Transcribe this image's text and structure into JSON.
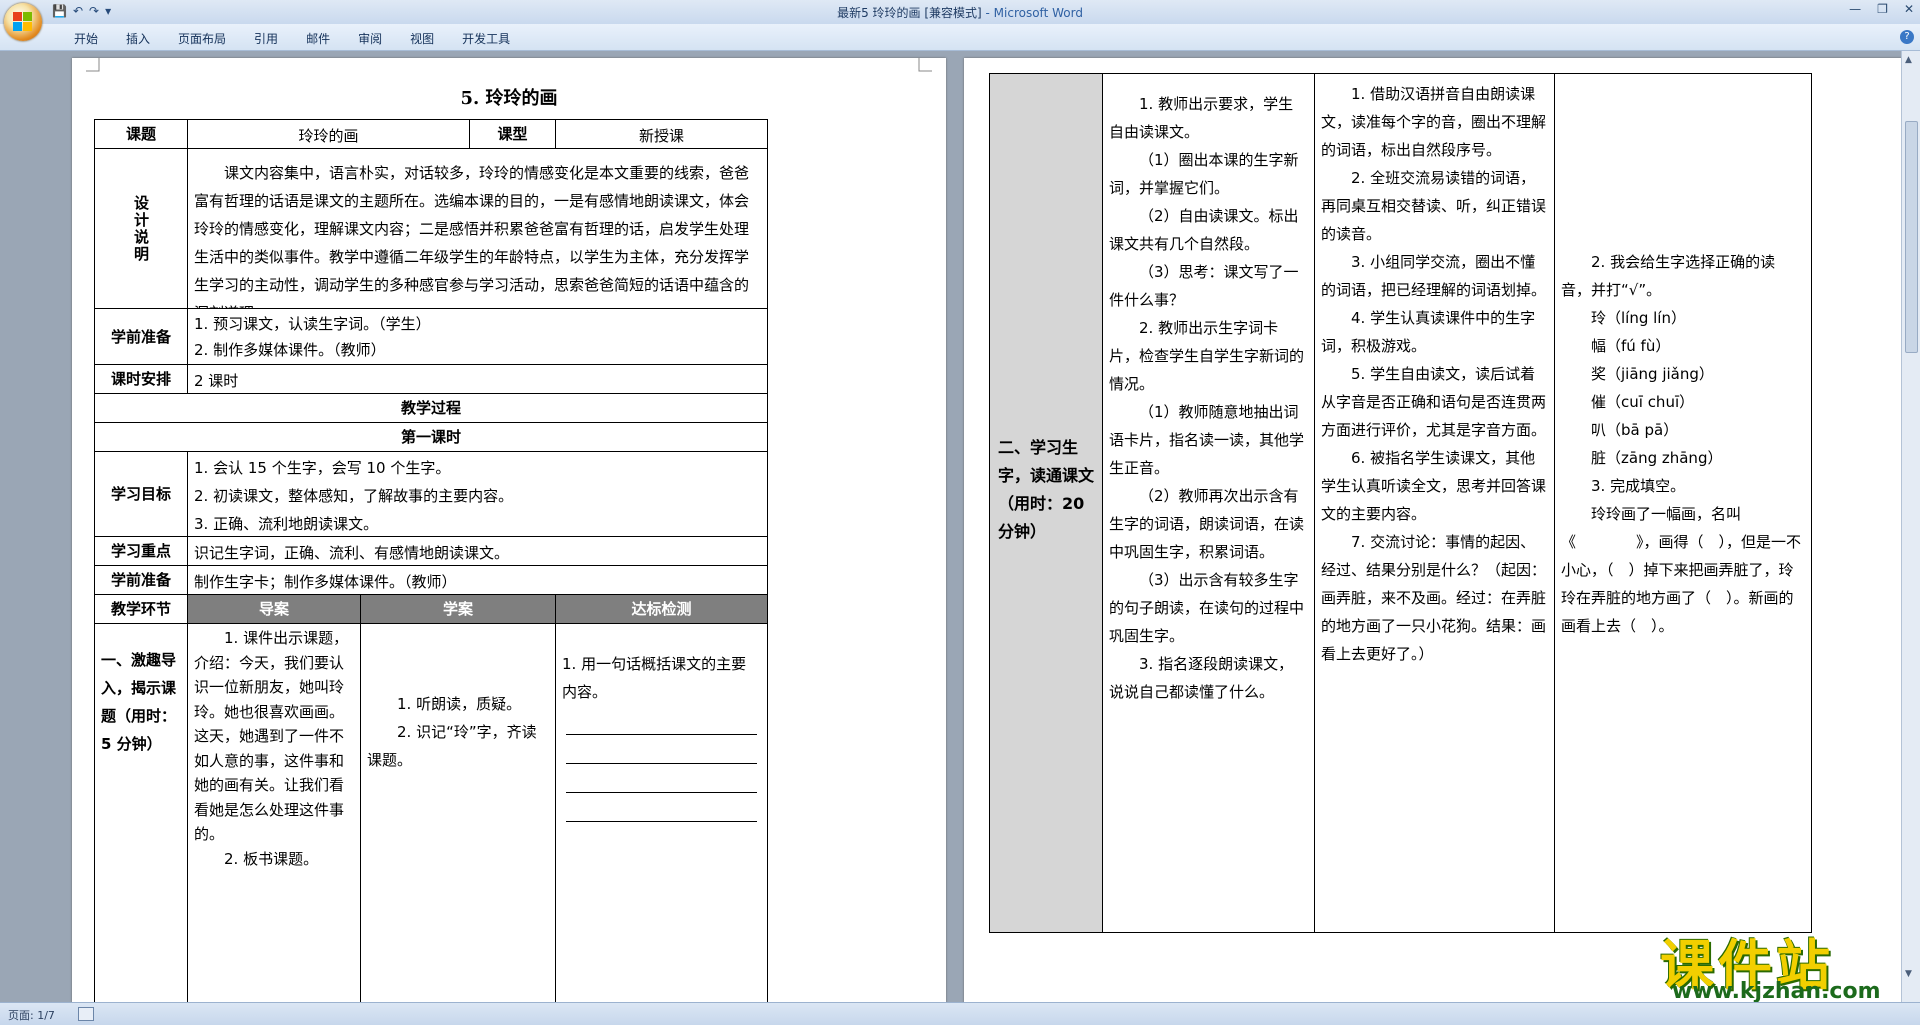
{
  "window": {
    "title": "最新5 玲玲的画 [兼容模式]",
    "app": " - Microsoft Word",
    "qat": [
      "💾",
      "↶",
      "↷",
      "▾"
    ]
  },
  "ribbon": {
    "tabs": [
      "开始",
      "插入",
      "页面布局",
      "引用",
      "邮件",
      "审阅",
      "视图",
      "开发工具"
    ]
  },
  "status": {
    "page": "页面: 1/7"
  },
  "page1": {
    "title": "5. 玲玲的画",
    "r1": {
      "label1": "课题",
      "value1": "玲玲的画",
      "label2": "课型",
      "value2": "新授课"
    },
    "design": {
      "label": "设计说明",
      "text": "课文内容集中，语言朴实，对话较多，玲玲的情感变化是本文重要的线索，爸爸富有哲理的话语是课文的主题所在。选编本课的目的，一是有感情地朗读课文，体会玲玲的情感变化，理解课文内容；二是感悟并积累爸爸富有哲理的话，启发学生处理生活中的类似事件。教学中遵循二年级学生的年龄特点，以学生为主体，充分发挥学生学习的主动性，调动学生的多种感官参与学习活动，思索爸爸简短的话语中蕴含的深刻道理。"
    },
    "prep": {
      "label": "学前准备",
      "items": [
        "1. 预习课文，认读生字词。（学生）",
        "2. 制作多媒体课件。（教师）"
      ]
    },
    "hours": {
      "label": "课时安排",
      "value": "2 课时"
    },
    "process": "教学过程",
    "lesson": "第一课时",
    "goals": {
      "label": "学习目标",
      "items": [
        "1. 会认 15 个生字，会写 10 个生字。",
        "2. 初读课文，整体感知，了解故事的主要内容。",
        "3. 正确、流利地朗读课文。"
      ]
    },
    "focus": {
      "label": "学习重点",
      "value": "识记生字词，正确、流利、有感情地朗读课文。"
    },
    "prep2": {
      "label": "学前准备",
      "value": "制作生字卡；制作多媒体课件。（教师）"
    },
    "head": {
      "c0": "教学环节",
      "c1": "导案",
      "c2": "学案",
      "c3": "达标检测"
    },
    "stage1": {
      "label": "一、激趣导入，揭示课题（用时：5 分钟）",
      "guide": [
        "1. 课件出示课题，介绍：今天，我们要认识一位新朋友，她叫玲玲。她也很喜欢画画。这天，她遇到了一件不如人意的事，这件事和她的画有关。让我们看看她是怎么处理这件事的。",
        "2. 板书课题。"
      ],
      "study": [
        "1. 听朗读，质疑。",
        "2. 识记“玲”字，齐读课题。"
      ],
      "test": "1. 用一句话概括课文的主要内容。"
    }
  },
  "page2": {
    "stage2": {
      "label": "二、学习生字，读通课文（用时：20 分钟）",
      "guide": [
        "1. 教师出示要求，学生自由读课文。",
        "（1）圈出本课的生字新词，并掌握它们。",
        "（2）自由读课文。标出课文共有几个自然段。",
        "（3）思考：课文写了一件什么事？",
        "2. 教师出示生字词卡片，检查学生自学生字新词的情况。",
        "（1）教师随意地抽出词语卡片，指名读一读，其他学生正音。",
        "（2）教师再次出示含有生字的词语，朗读词语，在读中巩固生字，积累词语。",
        "（3）出示含有较多生字的句子朗读，在读句的过程中巩固生字。",
        "3. 指名逐段朗读课文，说说自己都读懂了什么。"
      ],
      "study": [
        "1. 借助汉语拼音自由朗读课文，读准每个字的音，圈出不理解的词语，标出自然段序号。",
        "2. 全班交流易读错的词语，再同桌互相交替读、听，纠正错误的读音。",
        "3. 小组同学交流，圈出不懂的词语，把已经理解的词语划掉。",
        "4. 学生认真读课件中的生字词，积极游戏。",
        "5. 学生自由读文，读后试着从字音是否正确和语句是否连贯两方面进行评价，尤其是字音方面。",
        "6. 被指名学生读课文，其他学生认真听读全文，思考并回答课文的主要内容。",
        "7. 交流讨论：事情的起因、经过、结果分别是什么？（起因：画弄脏，来不及画。经过：在弄脏的地方画了一只小花狗。结果：画看上去更好了。）"
      ],
      "test": [
        "2. 我会给生字选择正确的读音，并打“√”。",
        "玲（líng  lín）",
        "幅（fú  fù）",
        "奖（jiāng jiǎng）",
        "催（cuī  chuī）",
        "叭（bā  pā）",
        "脏（zāng  zhāng）",
        "3. 完成填空。",
        "玲玲画了一幅画，名叫《　　　　》，画得（　），但是一不小心，（　）掉下来把画弄脏了，玲玲在弄脏的地方画了（　）。新画的画看上去（　）。"
      ]
    }
  },
  "watermark": {
    "main": "课件站",
    "url": "www.kjzhan.com"
  }
}
